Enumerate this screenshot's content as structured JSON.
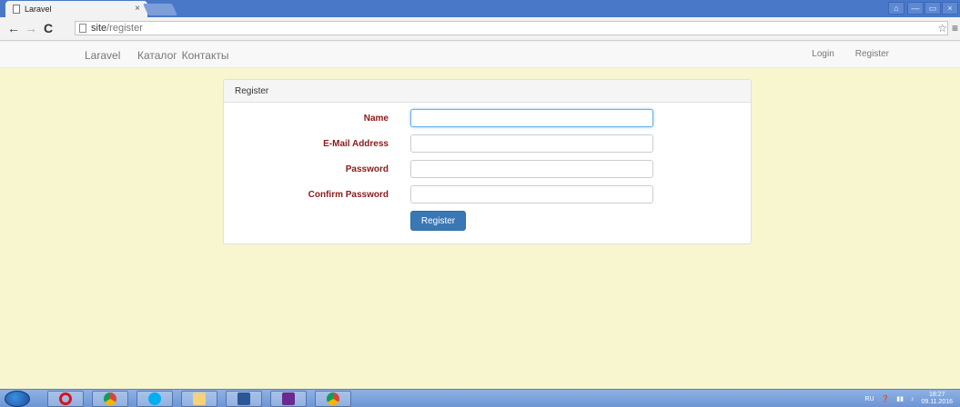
{
  "browser": {
    "tab_title": "Laravel",
    "tab_close": "×",
    "url_host": "site",
    "url_path": "/register",
    "win_controls": [
      "⌂",
      "—",
      "▭",
      "×"
    ]
  },
  "navbar": {
    "brand": "Laravel",
    "left_links": [
      "Каталог",
      "Контакты"
    ],
    "right_links": [
      "Login",
      "Register"
    ]
  },
  "panel": {
    "heading": "Register",
    "fields": [
      {
        "label": "Name",
        "value": ""
      },
      {
        "label": "E-Mail Address",
        "value": ""
      },
      {
        "label": "Password",
        "value": ""
      },
      {
        "label": "Confirm Password",
        "value": ""
      }
    ],
    "submit_label": "Register"
  },
  "taskbar": {
    "lang": "RU",
    "time": "18:27",
    "date": "09.11.2016"
  },
  "colors": {
    "page_bg": "#f8f6cf",
    "label": "#8b1a1a",
    "button": "#3a78b5"
  }
}
